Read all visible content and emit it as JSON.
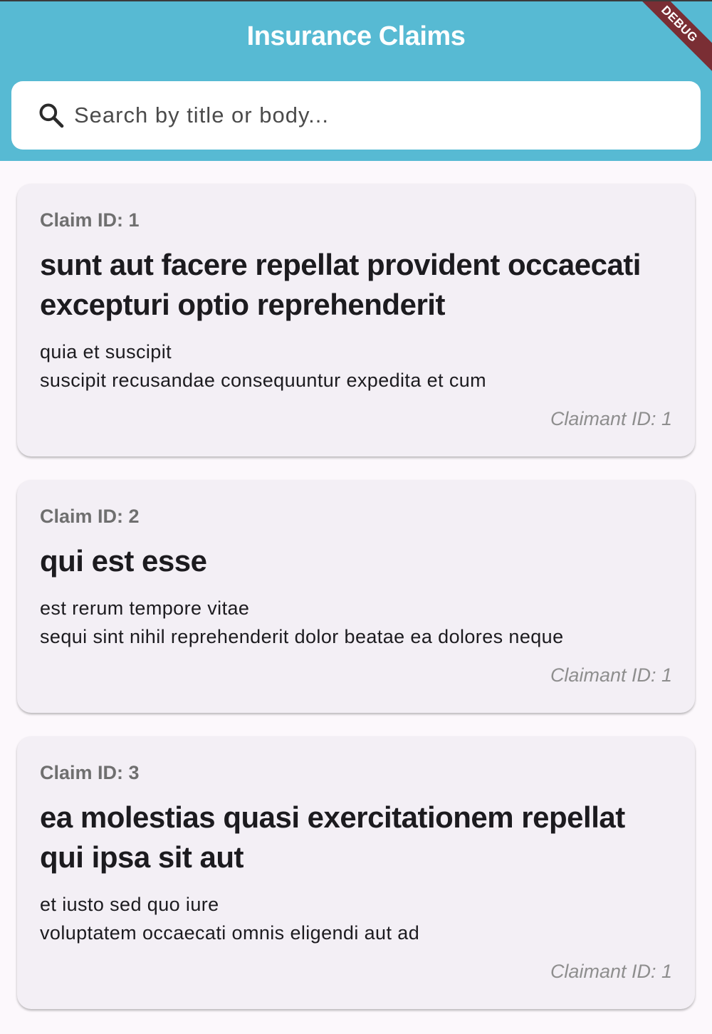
{
  "app": {
    "title": "Insurance Claims",
    "debug_label": "DEBUG"
  },
  "search": {
    "placeholder": "Search by title or body...",
    "value": ""
  },
  "colors": {
    "appbar": "#57BAD3",
    "background": "#FCF8FC",
    "card": "#F3EFF5",
    "debug_banner": "#7A2E34"
  },
  "claims": [
    {
      "id_label": "Claim ID: 1",
      "title": "sunt aut facere repellat provident occaecati excepturi optio reprehenderit",
      "body": "quia et suscipit\nsuscipit recusandae consequuntur expedita et cum",
      "claimant": "Claimant ID: 1"
    },
    {
      "id_label": "Claim ID: 2",
      "title": "qui est esse",
      "body": "est rerum tempore vitae\nsequi sint nihil reprehenderit dolor beatae ea dolores neque",
      "claimant": "Claimant ID: 1"
    },
    {
      "id_label": "Claim ID: 3",
      "title": "ea molestias quasi exercitationem repellat qui ipsa sit aut",
      "body": "et iusto sed quo iure\nvoluptatem occaecati omnis eligendi aut ad",
      "claimant": "Claimant ID: 1"
    }
  ]
}
